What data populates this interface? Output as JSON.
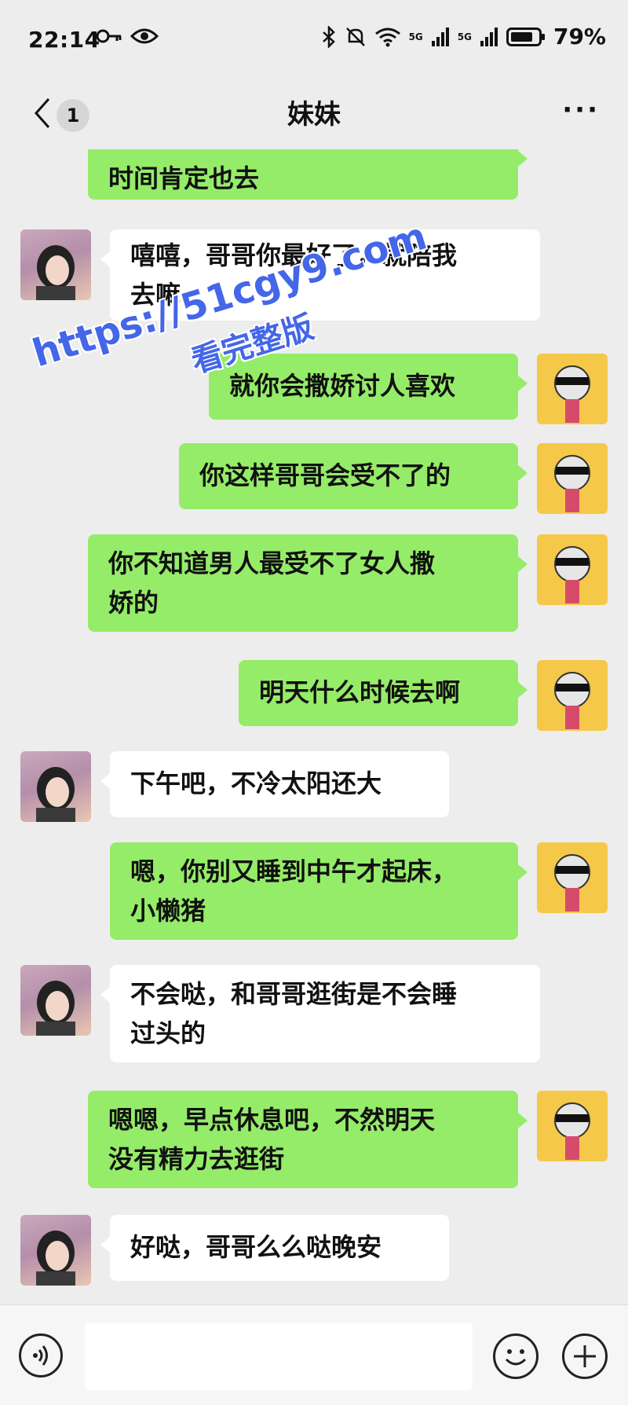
{
  "status_bar": {
    "time": "22:14",
    "network_labels": [
      "5G",
      "5G"
    ],
    "battery": "79%",
    "icons": [
      "key-icon",
      "eye-icon",
      "bluetooth-icon",
      "mute-icon",
      "wifi-icon",
      "signal-icon",
      "signal-icon",
      "battery-icon"
    ]
  },
  "header": {
    "unread_count": "1",
    "title": "妹妹",
    "more_label": "···"
  },
  "messages": [
    {
      "side": "me",
      "text": "时间肯定也去"
    },
    {
      "side": "other",
      "text": "嘻嘻，哥哥你最好了，就陪我\n去嘛"
    },
    {
      "side": "me",
      "text": "就你会撒娇讨人喜欢"
    },
    {
      "side": "me",
      "text": "你这样哥哥会受不了的"
    },
    {
      "side": "me",
      "text": "你不知道男人最受不了女人撒\n娇的"
    },
    {
      "side": "me",
      "text": "明天什么时候去啊"
    },
    {
      "side": "other",
      "text": "下午吧，不冷太阳还大"
    },
    {
      "side": "me",
      "text": "嗯，你别又睡到中午才起床，\n小懒猪"
    },
    {
      "side": "other",
      "text": "不会哒，和哥哥逛街是不会睡\n过头的"
    },
    {
      "side": "me",
      "text": "嗯嗯，早点休息吧，不然明天\n没有精力去逛街"
    },
    {
      "side": "other",
      "text": "好哒，哥哥么么哒晚安"
    }
  ],
  "watermark": {
    "line1": "https://51cgy9.com",
    "line2": "看完整版"
  },
  "input_bar": {
    "placeholder": "",
    "icons": [
      "voice-icon",
      "emoji-icon",
      "plus-icon"
    ]
  },
  "colors": {
    "background": "#ededed",
    "my_bubble": "#95ec69",
    "other_bubble": "#ffffff",
    "watermark": "#4466e8"
  }
}
